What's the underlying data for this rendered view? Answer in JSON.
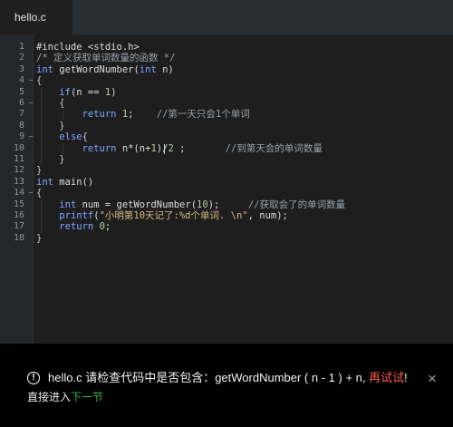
{
  "tab": {
    "filename": "hello.c"
  },
  "icons": {
    "fold_marker": "−",
    "warning_icon": "!",
    "close_icon": "×"
  },
  "code": {
    "lines": [
      {
        "number": "1",
        "fold": false,
        "tokens": [
          {
            "text": "#include <stdio.h>",
            "type": "ident"
          }
        ]
      },
      {
        "number": "2",
        "fold": false,
        "tokens": [
          {
            "text": "/* 定义获取单词数量的函数 */",
            "type": "comment"
          }
        ]
      },
      {
        "number": "3",
        "fold": false,
        "tokens": [
          {
            "text": "int",
            "type": "kw"
          },
          {
            "text": " getWordNumber(",
            "type": "ident"
          },
          {
            "text": "int",
            "type": "kw"
          },
          {
            "text": " n)",
            "type": "ident"
          }
        ]
      },
      {
        "number": "4",
        "fold": true,
        "tokens": [
          {
            "text": "{",
            "type": "punct"
          }
        ]
      },
      {
        "number": "5",
        "fold": false,
        "tokens": [
          {
            "text": "    ",
            "type": "ident"
          },
          {
            "text": "if",
            "type": "kw"
          },
          {
            "text": "(n == ",
            "type": "ident"
          },
          {
            "text": "1",
            "type": "number"
          },
          {
            "text": ")",
            "type": "ident"
          }
        ]
      },
      {
        "number": "6",
        "fold": true,
        "tokens": [
          {
            "text": "    {",
            "type": "punct"
          }
        ]
      },
      {
        "number": "7",
        "fold": false,
        "tokens": [
          {
            "text": "        ",
            "type": "ident"
          },
          {
            "text": "return",
            "type": "kw"
          },
          {
            "text": " ",
            "type": "ident"
          },
          {
            "text": "1",
            "type": "number"
          },
          {
            "text": ";    ",
            "type": "ident"
          },
          {
            "text": "//第一天只会1个单词",
            "type": "comment"
          }
        ]
      },
      {
        "number": "8",
        "fold": false,
        "tokens": [
          {
            "text": "    }",
            "type": "punct"
          }
        ]
      },
      {
        "number": "9",
        "fold": true,
        "tokens": [
          {
            "text": "    ",
            "type": "ident"
          },
          {
            "text": "else",
            "type": "kw"
          },
          {
            "text": "{",
            "type": "punct"
          }
        ]
      },
      {
        "number": "10",
        "fold": false,
        "tokens": [
          {
            "text": "        ",
            "type": "ident"
          },
          {
            "text": "return",
            "type": "kw"
          },
          {
            "text": " n*(n+",
            "type": "ident"
          },
          {
            "text": "1",
            "type": "number"
          },
          {
            "text": ")/",
            "type": "ident"
          },
          {
            "text": "2",
            "type": "number"
          },
          {
            "text": " ;       ",
            "type": "ident"
          },
          {
            "text": "//到第天会的单词数量",
            "type": "comment"
          }
        ]
      },
      {
        "number": "11",
        "fold": false,
        "tokens": [
          {
            "text": "    }",
            "type": "punct"
          }
        ]
      },
      {
        "number": "12",
        "fold": false,
        "tokens": [
          {
            "text": "}",
            "type": "punct"
          }
        ]
      },
      {
        "number": "13",
        "fold": false,
        "tokens": [
          {
            "text": "int",
            "type": "kw"
          },
          {
            "text": " main()",
            "type": "ident"
          }
        ]
      },
      {
        "number": "14",
        "fold": true,
        "tokens": [
          {
            "text": "{",
            "type": "punct"
          }
        ]
      },
      {
        "number": "15",
        "fold": false,
        "tokens": [
          {
            "text": "    ",
            "type": "ident"
          },
          {
            "text": "int",
            "type": "kw"
          },
          {
            "text": " num = getWordNumber(",
            "type": "ident"
          },
          {
            "text": "10",
            "type": "number"
          },
          {
            "text": ");     ",
            "type": "ident"
          },
          {
            "text": "//获取会了的单词数量",
            "type": "comment"
          }
        ]
      },
      {
        "number": "16",
        "fold": false,
        "tokens": [
          {
            "text": "    ",
            "type": "ident"
          },
          {
            "text": "printf",
            "type": "kw"
          },
          {
            "text": "(",
            "type": "ident"
          },
          {
            "text": "\"小明第10天记了:%d个单词. \\n\"",
            "type": "string"
          },
          {
            "text": ", num);",
            "type": "ident"
          }
        ]
      },
      {
        "number": "17",
        "fold": false,
        "tokens": [
          {
            "text": "    ",
            "type": "ident"
          },
          {
            "text": "return",
            "type": "kw"
          },
          {
            "text": " ",
            "type": "ident"
          },
          {
            "text": "0",
            "type": "number"
          },
          {
            "text": ";",
            "type": "ident"
          }
        ]
      },
      {
        "number": "18",
        "fold": false,
        "tokens": [
          {
            "text": "}",
            "type": "punct"
          }
        ]
      }
    ]
  },
  "notice": {
    "message_prefix": "hello.c 请检查代码中是否包含：getWordNumber ( n - 1 ) + n,",
    "retry_label": "再试试",
    "message_suffix": "!",
    "continue_prefix": "直接进入",
    "next_label": "下一节"
  }
}
